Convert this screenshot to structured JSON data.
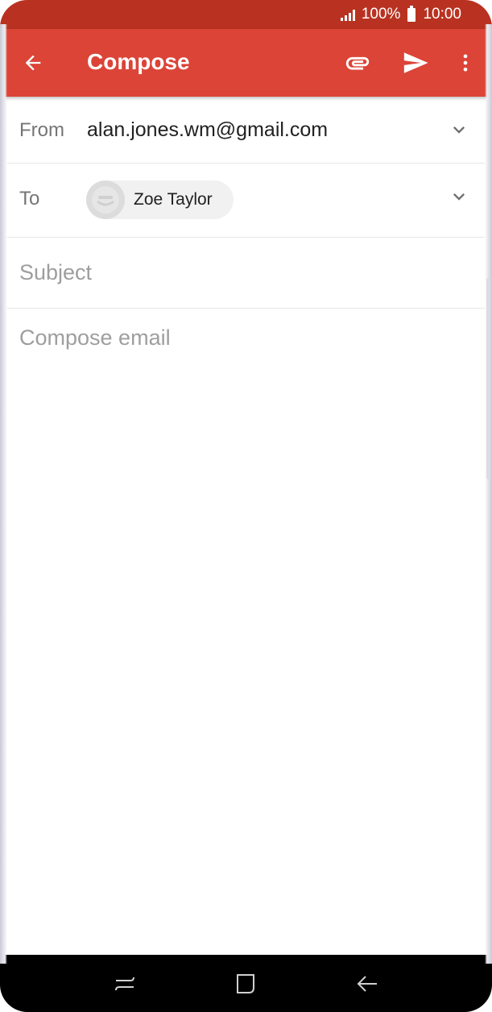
{
  "status_bar": {
    "battery": "100%",
    "time": "10:00"
  },
  "app_bar": {
    "title": "Compose",
    "icons": {
      "back": "arrow-left-icon",
      "attach": "paperclip-icon",
      "send": "send-icon",
      "more": "more-vert-icon"
    }
  },
  "form": {
    "from_label": "From",
    "from_value": "alan.jones.wm@gmail.com",
    "to_label": "To",
    "recipients": [
      {
        "name": "Zoe Taylor"
      }
    ],
    "subject_placeholder": "Subject",
    "body_placeholder": "Compose email"
  },
  "nav_bar": {
    "icons": [
      "recents-icon",
      "home-icon",
      "back-icon"
    ]
  },
  "colors": {
    "status_bar": "#b93221",
    "app_bar": "#db4437",
    "nav_bar": "#000000",
    "placeholder": "#9e9e9e",
    "label": "#757575"
  }
}
